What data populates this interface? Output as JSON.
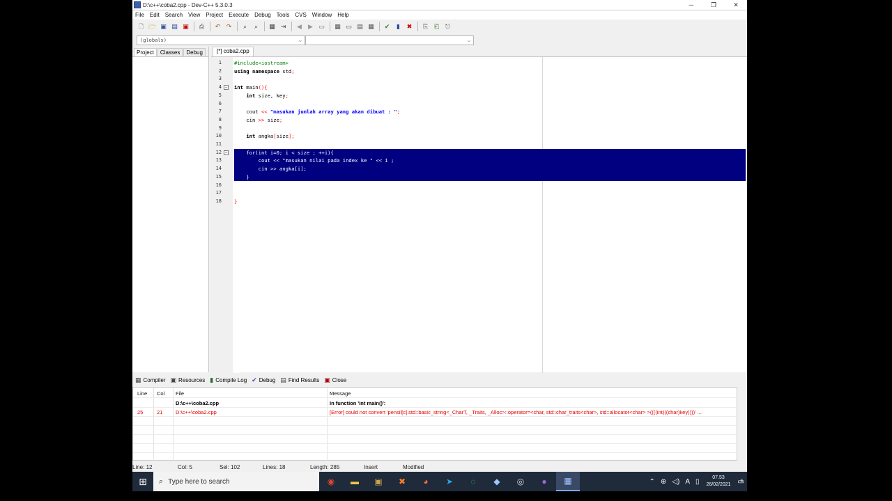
{
  "window": {
    "title": "D:\\c++\\coba2.cpp - Dev-C++ 5.3.0.3",
    "controls": {
      "minimize": "─",
      "restore": "❐",
      "close": "✕"
    }
  },
  "menu": [
    "File",
    "Edit",
    "Search",
    "View",
    "Project",
    "Execute",
    "Debug",
    "Tools",
    "CVS",
    "Window",
    "Help"
  ],
  "combos": {
    "scope": "(globals)",
    "member": ""
  },
  "left_tabs": [
    "Project",
    "Classes",
    "Debug"
  ],
  "file_tab": "[*] coba2.cpp",
  "editor": {
    "lines": [
      {
        "n": "1",
        "code": "#include<iostream>"
      },
      {
        "n": "2",
        "code": "using namespace std;"
      },
      {
        "n": "3",
        "code": ""
      },
      {
        "n": "4",
        "code": "int main(){"
      },
      {
        "n": "5",
        "code": "    int size, key;"
      },
      {
        "n": "6",
        "code": ""
      },
      {
        "n": "7",
        "code": "    cout << \"masukan jumlah array yang akan dibuat : \";"
      },
      {
        "n": "8",
        "code": "    cin >> size;"
      },
      {
        "n": "9",
        "code": ""
      },
      {
        "n": "10",
        "code": "    int angka[size];"
      },
      {
        "n": "11",
        "code": ""
      },
      {
        "n": "12",
        "code": "    for(int i=0; i < size ; ++i){"
      },
      {
        "n": "13",
        "code": "        cout << \"masukan nilai pada index ke \" << i ;"
      },
      {
        "n": "14",
        "code": "        cin >> angka[i];"
      },
      {
        "n": "15",
        "code": "    }"
      },
      {
        "n": "16",
        "code": ""
      },
      {
        "n": "17",
        "code": ""
      },
      {
        "n": "18",
        "code": "}"
      }
    ]
  },
  "bottom_tabs": [
    "Compiler",
    "Resources",
    "Compile Log",
    "Debug",
    "Find Results",
    "Close"
  ],
  "messages": {
    "headers": {
      "line": "Line",
      "col": "Col",
      "file": "File",
      "message": "Message"
    },
    "rows": [
      {
        "line": "",
        "col": "",
        "file": "D:\\c++\\coba2.cpp",
        "message": "In function 'int main()':",
        "type": "info"
      },
      {
        "line": "25",
        "col": "21",
        "file": "D:\\c++\\coba2.cpp",
        "message": "[Error] could not convert 'pensil[c].std::basic_string<_CharT, _Traits, _Alloc>::operator=<char, std::char_traits<char>, std::allocator<char> >((((int)((char)key))))' ...",
        "type": "error"
      }
    ]
  },
  "status": {
    "line": "Line:   12",
    "col": "Col:   5",
    "sel": "Sel:   102",
    "lines": "Lines:   18",
    "length": "Length:   285",
    "mode": "Insert",
    "modified": "Modified"
  },
  "taskbar": {
    "search_placeholder": "Type here to search",
    "time": "07.53",
    "date": "26/02/2021",
    "notifications": "8"
  }
}
